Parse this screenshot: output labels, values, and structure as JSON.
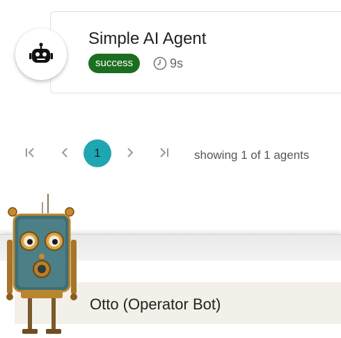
{
  "agent": {
    "name": "Simple AI Agent",
    "status": "success",
    "duration": "9s",
    "avatar_icon": "robot-icon",
    "status_color": "#1b6e1f"
  },
  "pagination": {
    "current_page": "1",
    "showing_text": "showing 1 of 1 agents",
    "accent": "#20a5b2",
    "icons": [
      "first-page-icon",
      "previous-page-icon",
      "next-page-icon",
      "last-page-icon"
    ]
  },
  "operator": {
    "name": "Otto (Operator Bot)",
    "mascot_icon": "robot-mascot-icon"
  }
}
